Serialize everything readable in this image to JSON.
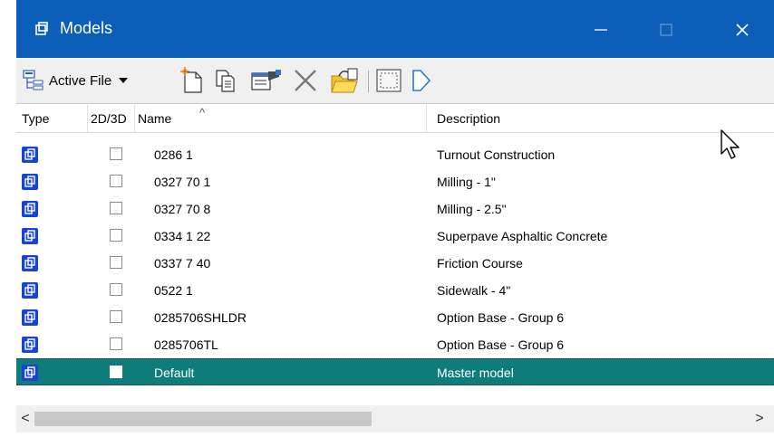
{
  "window": {
    "title": "Models",
    "icon": "model-icon"
  },
  "titlebar_buttons": {
    "minimize": "—",
    "maximize": "☐",
    "close": "✕"
  },
  "toolbar": {
    "active_file_label": "Active File",
    "buttons": [
      "create-model-icon",
      "copy-model-icon",
      "properties-icon",
      "delete-icon",
      "import-icon",
      "select-frame-icon",
      "arrow-model-icon"
    ]
  },
  "columns": {
    "type": "Type",
    "dim": "2D/3D",
    "name": "Name",
    "sort": "^",
    "description": "Description"
  },
  "rows": [
    {
      "name": "0286  1",
      "description": "Turnout Construction"
    },
    {
      "name": "0327 70  1",
      "description": "Milling - 1\""
    },
    {
      "name": "0327 70  8",
      "description": "Milling - 2.5\""
    },
    {
      "name": "0334  1 22",
      "description": "Superpave Asphaltic Concrete"
    },
    {
      "name": "0337  7 40",
      "description": "Friction Course"
    },
    {
      "name": "0522  1",
      "description": "Sidewalk - 4\""
    },
    {
      "name": "0285706SHLDR",
      "description": "Option Base - Group 6"
    },
    {
      "name": "0285706TL",
      "description": "Option Base - Group 6"
    },
    {
      "name": "Default",
      "description": "Master model"
    }
  ],
  "selected_row": "Default",
  "scrollbar": {
    "left": "<",
    "right": ">"
  },
  "colors": {
    "titlebar": "#0b5fb8",
    "selected": "#0e7c7b",
    "icon": "#1744d6"
  }
}
